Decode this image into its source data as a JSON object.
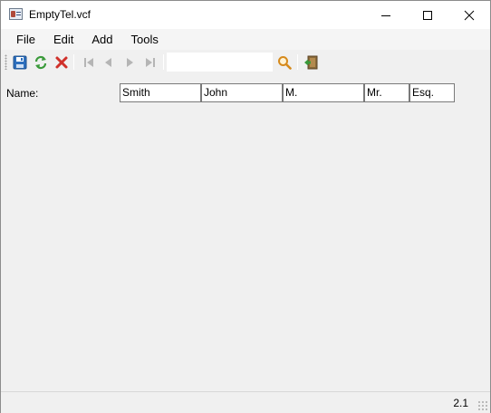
{
  "window": {
    "title": "EmptyTel.vcf",
    "icon": "contact-card-icon"
  },
  "menu": [
    "File",
    "Edit",
    "Add",
    "Tools"
  ],
  "toolbar": {
    "buttons": [
      {
        "name": "save-icon",
        "enabled": true
      },
      {
        "name": "refresh-icon",
        "enabled": true
      },
      {
        "name": "delete-icon",
        "enabled": true
      },
      {
        "name": "first-record-icon",
        "enabled": false
      },
      {
        "name": "previous-record-icon",
        "enabled": false
      },
      {
        "name": "next-record-icon",
        "enabled": false
      },
      {
        "name": "last-record-icon",
        "enabled": false
      },
      {
        "name": "search-icon",
        "enabled": true
      },
      {
        "name": "exit-icon",
        "enabled": true
      }
    ],
    "search_value": ""
  },
  "form": {
    "name_label": "Name:",
    "fields": {
      "family": "Smith",
      "given": "John",
      "middle": "M.",
      "prefix": "Mr.",
      "suffix": "Esq."
    }
  },
  "status": {
    "version": "2.1"
  },
  "colors": {
    "accent_blue": "#2d6fbd",
    "refresh_green": "#3a9a3a",
    "delete_red": "#d0302a",
    "search_orange": "#d68a1c"
  }
}
